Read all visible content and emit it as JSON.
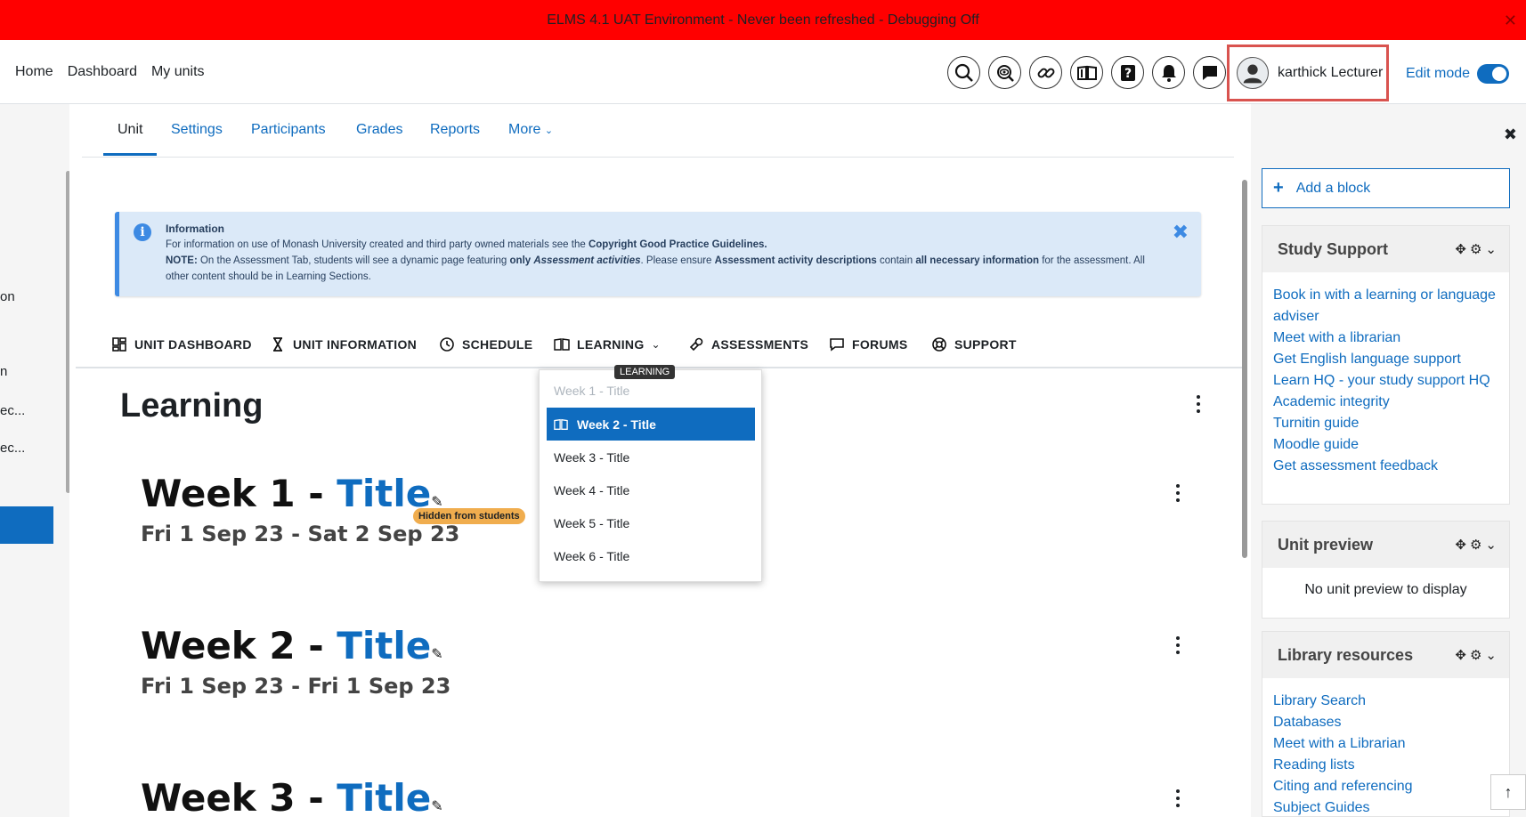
{
  "env_banner": {
    "text": "ELMS 4.1 UAT Environment - Never been refreshed - Debugging Off",
    "close": "✕"
  },
  "navbar": {
    "primary": [
      "Home",
      "Dashboard",
      "My units"
    ],
    "icons": [
      "search-icon",
      "preview-icon",
      "link-icon",
      "library-icon",
      "help-icon",
      "notifications-icon",
      "messages-icon"
    ],
    "user_name": "karthick Lecturer",
    "edit_mode_label": "Edit mode",
    "edit_mode_on": true
  },
  "left_drawer": {
    "fragments": [
      "on",
      "n",
      "ec...",
      "ec..."
    ]
  },
  "secondary_nav": {
    "tabs": [
      "Unit",
      "Settings",
      "Participants",
      "Grades",
      "Reports",
      "More"
    ],
    "active": "Unit"
  },
  "info_alert": {
    "title": "Information",
    "line1_pre": "For information on use of Monash University created and third party owned materials see the ",
    "line1_bold": "Copyright Good Practice Guidelines.",
    "note_label": "NOTE:",
    "note_1": " On the Assessment Tab, students will see a dynamic page featuring ",
    "note_only": "only",
    "note_italic": "Assessment activities",
    "note_2": ". Please ensure ",
    "note_bold1": "Assessment activity descriptions",
    "note_3": " contain ",
    "note_bold2": "all necessary information",
    "note_4": " for the assessment. All other content should be in Learning Sections.",
    "close": "✖"
  },
  "course_tabs": [
    {
      "label": "UNIT DASHBOARD",
      "icon": "dashboard-icon"
    },
    {
      "label": "UNIT INFORMATION",
      "icon": "hourglass-icon"
    },
    {
      "label": "SCHEDULE",
      "icon": "clock-icon"
    },
    {
      "label": "LEARNING",
      "icon": "book-icon"
    },
    {
      "label": "ASSESSMENTS",
      "icon": "assessment-icon"
    },
    {
      "label": "FORUMS",
      "icon": "chat-icon"
    },
    {
      "label": "SUPPORT",
      "icon": "lifebuoy-icon"
    }
  ],
  "tooltip": "LEARNING",
  "dropdown": {
    "items": [
      "Week 1 - Title",
      "Week 2 - Title",
      "Week 3 - Title",
      "Week 4 - Title",
      "Week 5 - Title",
      "Week 6 - Title"
    ],
    "selected": "Week 2 - Title",
    "disabled": "Week 1 - Title"
  },
  "page_heading": "Learning",
  "sections": [
    {
      "prefix": "Week 1 - ",
      "title": "Title",
      "dates": "Fri 1 Sep 23 - Sat 2 Sep 23",
      "badge": "Hidden from students"
    },
    {
      "prefix": "Week 2 - ",
      "title": "Title",
      "dates": "Fri 1 Sep 23 - Fri 1 Sep 23"
    },
    {
      "prefix": "Week 3 - ",
      "title": "Title"
    }
  ],
  "right_drawer": {
    "add_block": "Add a block",
    "study_support": {
      "title": "Study Support",
      "links": [
        "Book in with a learning or language adviser",
        "Meet with a librarian",
        "Get English language support",
        "Learn HQ - your study support HQ",
        "Academic integrity",
        "Turnitin guide",
        "Moodle guide",
        "Get assessment feedback"
      ]
    },
    "unit_preview": {
      "title": "Unit preview",
      "empty": "No unit preview to display"
    },
    "library_resources": {
      "title": "Library resources",
      "links": [
        "Library Search",
        "Databases",
        "Meet with a Librarian",
        "Reading lists",
        "Citing and referencing",
        "Subject Guides"
      ]
    }
  },
  "colors": {
    "banner": "#ff0000",
    "brand_blue": "#0f6cbf",
    "badge": "#f0ad4e",
    "alert_bg": "#dbe9f8"
  }
}
